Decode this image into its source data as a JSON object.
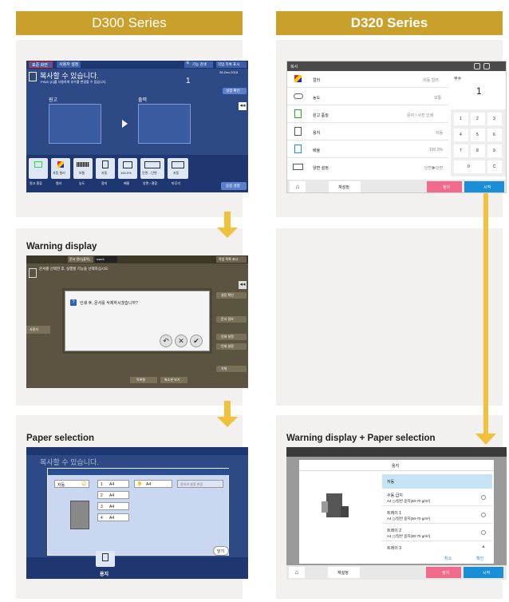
{
  "headers": {
    "d300": "D300 Series",
    "d320": "D320 Series"
  },
  "panels": {
    "warning_display": "Warning display",
    "paper_selection": "Paper selection",
    "warning_paper": "Warning display + Paper selection"
  },
  "d300_main": {
    "tabs": [
      "표준 화면",
      "사용자 설정"
    ],
    "search": "기능 검색",
    "job_list": "작업 목록 표시",
    "status": "복사할 수 있습니다.",
    "status_sub": "PIN/C [C]를 사용하여 부수를 변경할 수 있습니다.",
    "copies": "1",
    "date": "26-Dec-2018",
    "side_btn": "설정 확인",
    "original": "원고",
    "output": "출력",
    "buttons": [
      "원고 종류",
      "컬러",
      "농도",
      "용지",
      "배율",
      "양면 / 결합",
      "마무리"
    ],
    "btn_values": [
      "",
      "자동 컬러",
      "보통",
      "자동",
      "100.0%",
      "단면→단면",
      "자동"
    ],
    "apply": "응용 설정"
  },
  "d320_main": {
    "title": "복사",
    "rows": [
      {
        "label": "컬러",
        "value": "자동 컬러"
      },
      {
        "label": "농도",
        "value": "보통"
      },
      {
        "label": "원고 품질",
        "value": "문자 / 사진 인쇄"
      },
      {
        "label": "용지",
        "value": "자동"
      },
      {
        "label": "배율",
        "value": "100.0%"
      },
      {
        "label": "양면 설정",
        "value": "단면▶단면"
      }
    ],
    "copies_label": "부수",
    "copies": "1",
    "keys": [
      "1",
      "2",
      "3",
      "4",
      "5",
      "6",
      "7",
      "8",
      "9",
      "0",
      "C"
    ],
    "reset": "재설정",
    "stop": "정지",
    "start": "시작"
  },
  "warning_d300": {
    "tab": "문서 관리(출력)",
    "user": "user1",
    "job_list": "작업 목록 표시",
    "message": "문서를 선택한 후, 실행할 기능을 선택하십시오.",
    "dialog_text": "인쇄 후, 문서를 삭제하시겠습니까?",
    "left_btn": "사용자",
    "right_btns": [
      "설정 확인",
      "문서 정보",
      "인쇄 설정",
      "인쇄 설정",
      "삭제"
    ],
    "bottom_btns": [
      "목록형",
      "축소판 보기"
    ]
  },
  "paper_d300": {
    "tray_auto": "자동",
    "trays": [
      "A4",
      "A4",
      "A4",
      "A4"
    ],
    "tray_nums": [
      "1",
      "2",
      "3",
      "4"
    ],
    "bypass": "A4",
    "hint": "용지와 설정 변경",
    "close": "닫기",
    "status": "복사할 수 있습니다.",
    "selected_btn": "용지"
  },
  "paper_d320": {
    "dialog_title": "용지",
    "items": [
      {
        "title": "자동",
        "sub": ""
      },
      {
        "title": "수동 급지",
        "sub": "A4 ◻/일반 용지(60-70 g/m²)"
      },
      {
        "title": "트레이 1",
        "sub": "A4 ◻/일반 용지(60-70 g/m²)"
      },
      {
        "title": "트레이 2",
        "sub": "A4 ◻/일반 용지(60-70 g/m²)"
      },
      {
        "title": "트레이 3",
        "sub": ""
      }
    ],
    "cancel": "취소",
    "ok": "확인",
    "reset": "재설정",
    "stop": "정지",
    "start": "시작"
  },
  "colors": {
    "gold": "#c8a02b",
    "arrow": "#f0c23c",
    "panel": "#f2f1ef",
    "accent_blue": "#1a8fd8",
    "stop_pink": "#f06a8c"
  }
}
